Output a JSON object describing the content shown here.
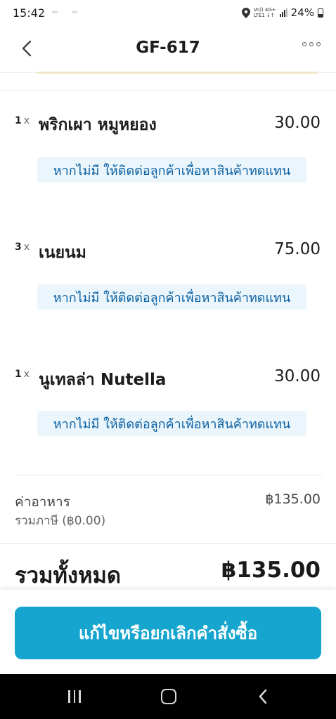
{
  "status_bar": {
    "time": "15:42",
    "network": "Vo)) 4G+ LTE1",
    "battery": "24%"
  },
  "header": {
    "title": "GF-617"
  },
  "items": [
    {
      "qty": "1",
      "x": "x",
      "name": "พริกเผา หมูหยอง",
      "price": "30.00",
      "note": "หากไม่มี ให้ติดต่อลูกค้าเพื่อหาสินค้าทดแทน"
    },
    {
      "qty": "3",
      "x": "x",
      "name": "เนยนม",
      "price": "75.00",
      "note": "หากไม่มี ให้ติดต่อลูกค้าเพื่อหาสินค้าทดแทน"
    },
    {
      "qty": "1",
      "x": "x",
      "name": "นูเทลล่า Nutella",
      "price": "30.00",
      "note": "หากไม่มี ให้ติดต่อลูกค้าเพื่อหาสินค้าทดแทน"
    }
  ],
  "summary": {
    "food_label": "ค่าอาหาร",
    "food_value": "฿135.00",
    "tax_label": "รวมภาษี (฿0.00)",
    "total_label": "รวมทั้งหมด",
    "total_value": "฿135.00"
  },
  "action": {
    "button_label": "แก้ไขหรือยกเลิกคำสั่งซื้อ"
  },
  "colors": {
    "accent": "#15a5cf",
    "note_bg": "#eaf6fb",
    "note_text": "#0a5fa3"
  }
}
